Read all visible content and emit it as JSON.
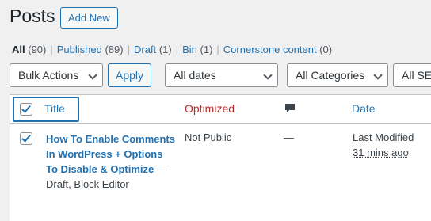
{
  "header": {
    "title": "Posts",
    "add_new_label": "Add New"
  },
  "views": [
    {
      "label": "All",
      "count": "(90)"
    },
    {
      "label": "Published",
      "count": "(89)"
    },
    {
      "label": "Draft",
      "count": "(1)"
    },
    {
      "label": "Bin",
      "count": "(1)"
    },
    {
      "label": "Cornerstone content",
      "count": "(0)"
    }
  ],
  "filters": {
    "bulk_actions": "Bulk Actions",
    "apply_label": "Apply",
    "dates": "All dates",
    "categories": "All Categories",
    "seo": "All SEO"
  },
  "table": {
    "columns": {
      "title": "Title",
      "optimized": "Optimized",
      "comments_icon": "comment-bubble-icon",
      "date": "Date"
    },
    "rows": [
      {
        "checked": true,
        "title_link": "How To Enable Comments In WordPress + Options To Disable & Optimize",
        "title_state": "— Draft, Block Editor",
        "optimized": "Not Public",
        "comments": "—",
        "date_status": "Last Modified",
        "date_ago": "31 mins ago"
      }
    ]
  },
  "colors": {
    "accent": "#2271b1",
    "optimized_header": "#b32d2e",
    "background": "#f0f0f1"
  }
}
